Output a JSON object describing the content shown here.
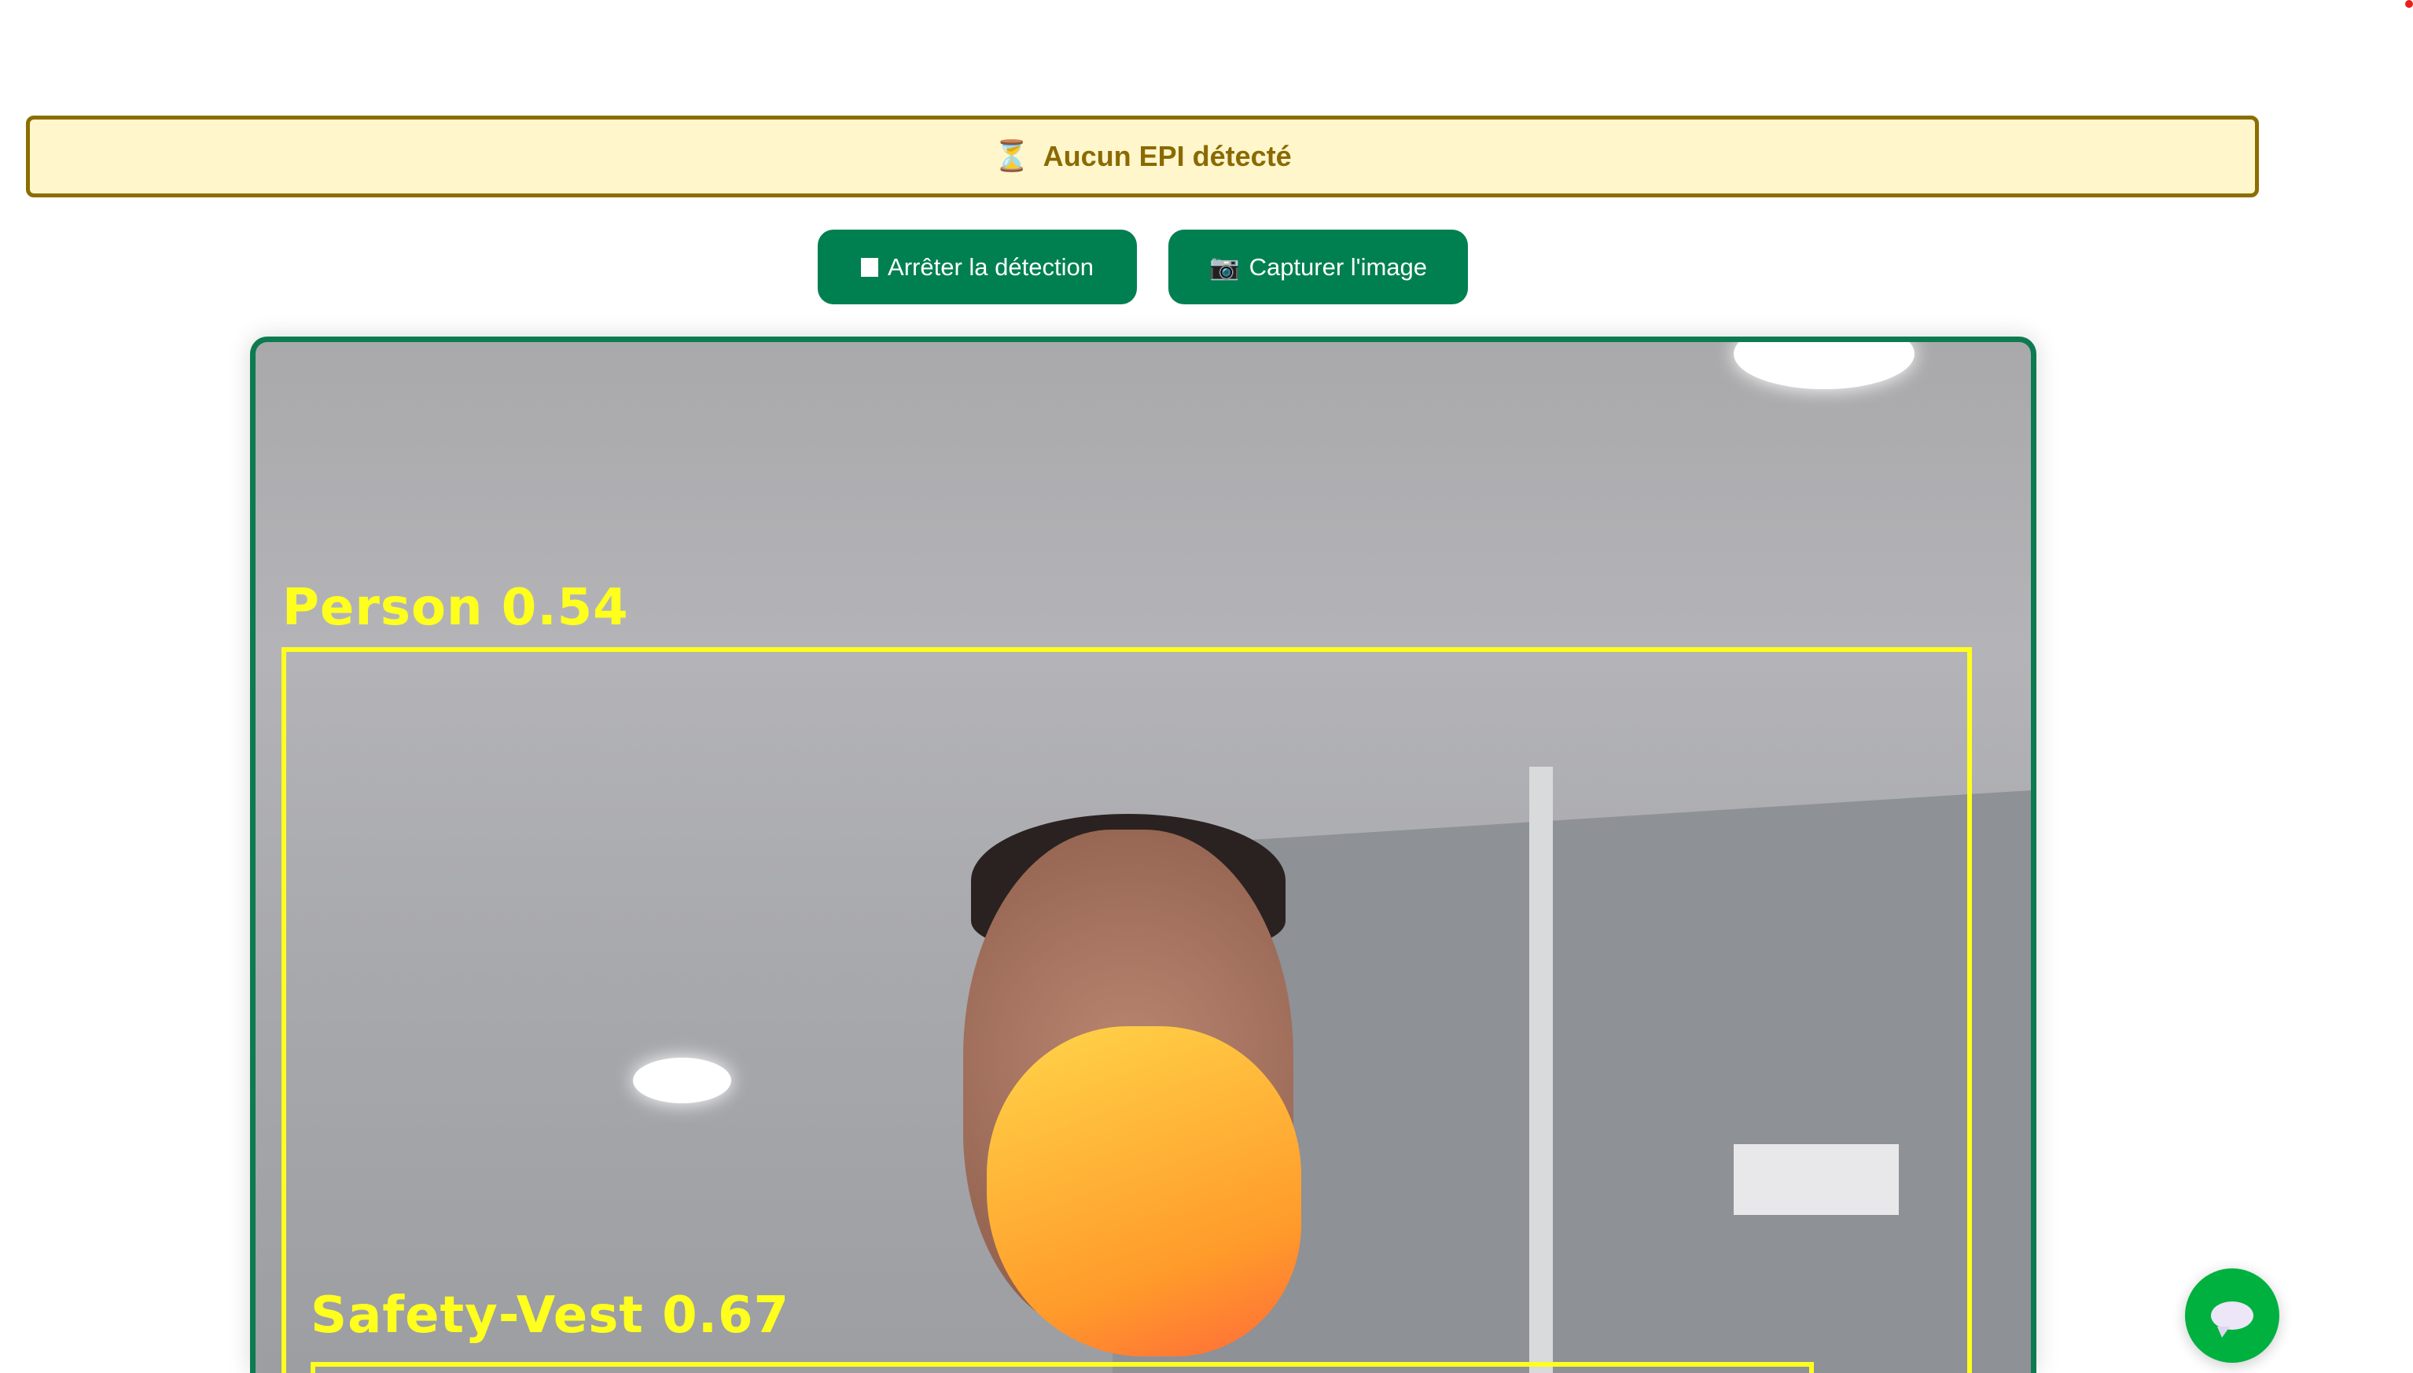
{
  "status_banner": {
    "icon": "hourglass-icon",
    "icon_glyph": "⏳",
    "text": "Aucun EPI détecté",
    "color": "#8a6a00",
    "background": "#fff6cc"
  },
  "buttons": {
    "stop": {
      "label": "Arrêter la détection",
      "icon": "stop-square-icon"
    },
    "capture": {
      "label": "Capturer l'image",
      "icon": "camera-icon",
      "icon_glyph": "📷"
    }
  },
  "video": {
    "detections": [
      {
        "label": "Person 0.54"
      },
      {
        "label": "Safety-Vest 0.67"
      }
    ],
    "box_color": "#ffff1e",
    "border_color": "#0d7a50"
  },
  "chat_button": {
    "icon": "speech-bubble-icon",
    "color": "#00b140"
  },
  "accent": "#008050"
}
